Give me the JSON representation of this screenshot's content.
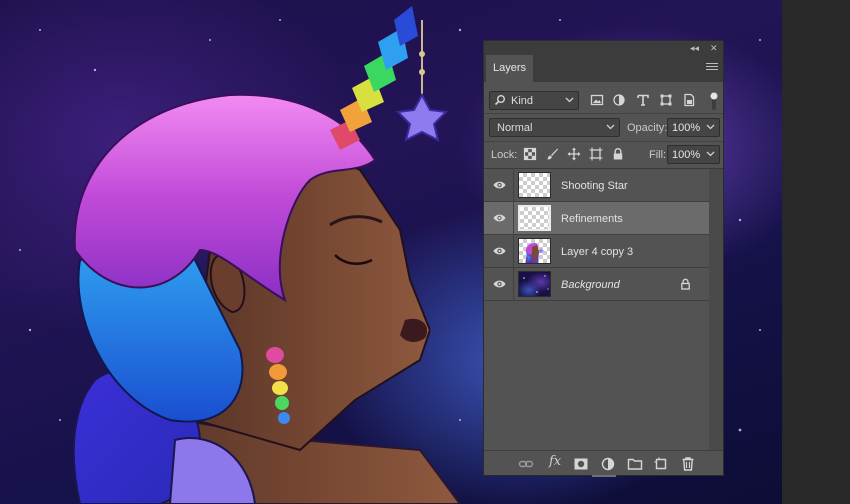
{
  "panel": {
    "tab_label": "Layers",
    "filter": {
      "value": "Kind",
      "icons": [
        "image-filter-icon",
        "adjustment-filter-icon",
        "type-filter-icon",
        "shape-filter-icon",
        "smart-object-filter-icon"
      ]
    },
    "blend_mode": "Normal",
    "opacity_label": "Opacity:",
    "opacity_value": "100%",
    "lock_label": "Lock:",
    "lock_icons": [
      "lock-transparent-pixels-icon",
      "lock-image-pixels-icon",
      "lock-position-icon",
      "lock-artboard-icon",
      "lock-all-icon"
    ],
    "fill_label": "Fill:",
    "fill_value": "100%",
    "layers": [
      {
        "name": "Shooting Star",
        "visible": true,
        "selected": false,
        "locked": false,
        "thumbnail": "transparent"
      },
      {
        "name": "Refinements",
        "visible": true,
        "selected": true,
        "locked": false,
        "thumbnail": "transparent"
      },
      {
        "name": "Layer 4 copy 3",
        "visible": true,
        "selected": false,
        "locked": false,
        "thumbnail": "figure"
      },
      {
        "name": "Background",
        "visible": true,
        "selected": false,
        "locked": true,
        "thumbnail": "galaxy"
      }
    ],
    "bottom_icons": [
      "link-layers-icon",
      "fx-icon",
      "layer-mask-icon",
      "adjustment-layer-icon",
      "group-folder-icon",
      "new-layer-icon",
      "trash-icon"
    ],
    "fx_label": "fx"
  },
  "colors": {
    "panel_bg": "#535353",
    "selected_row": "#6b6b6b",
    "canvas_bg": "#1c1048"
  }
}
